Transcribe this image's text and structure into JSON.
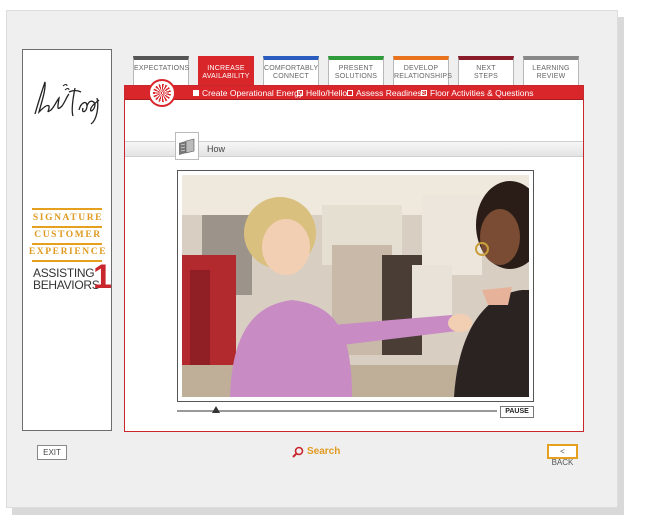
{
  "brand": {
    "logo_text": "Lord & Taylor",
    "signature_lines": [
      "SIGNATURE",
      "CUSTOMER",
      "EXPERIENCE"
    ],
    "module_title_line1": "ASSISTING",
    "module_title_line2": "BEHAVIORS",
    "module_number": "1"
  },
  "tabs": [
    {
      "line1": "EXPECTATIONS",
      "line2": "",
      "color": "#555555",
      "active": false
    },
    {
      "line1": "INCREASE",
      "line2": "AVAILABILITY",
      "color": "#d8262b",
      "active": true
    },
    {
      "line1": "COMFORTABLY",
      "line2": "CONNECT",
      "color": "#2a5bbf",
      "active": false
    },
    {
      "line1": "PRESENT",
      "line2": "SOLUTIONS",
      "color": "#2f9b3a",
      "active": false
    },
    {
      "line1": "DEVELOP",
      "line2": "RELATIONSHIPS",
      "color": "#e8731c",
      "active": false
    },
    {
      "line1": "NEXT",
      "line2": "STEPS",
      "color": "#8a1c2a",
      "active": false
    },
    {
      "line1": "LEARNING",
      "line2": "REVIEW",
      "color": "#888888",
      "active": false
    }
  ],
  "subnav": [
    {
      "label": "Create Operational Energy",
      "filled": true
    },
    {
      "label": "Hello/Hello",
      "filled": false
    },
    {
      "label": "Assess Readiness",
      "filled": false
    },
    {
      "label": "Floor Activities & Questions",
      "filled": false
    }
  ],
  "section": {
    "how_label": "How"
  },
  "video": {
    "progress": 0.12,
    "pause_label": "PAUSE"
  },
  "footer": {
    "exit_label": "EXIT",
    "search_label": "Search",
    "back_label": "< BACK"
  },
  "colors": {
    "accent_red": "#d8262b",
    "accent_gold": "#e09a20"
  }
}
